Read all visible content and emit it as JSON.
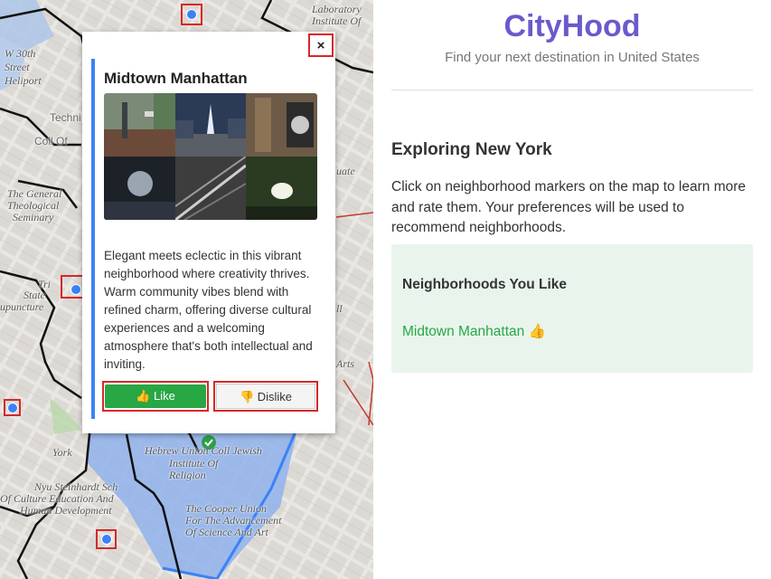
{
  "map": {
    "labels": [
      "Laboratory",
      "Institute Of",
      "W 30th",
      "Street",
      "Heliport",
      "Techni",
      "Coll Of",
      "The General",
      "Theological",
      "Seminary",
      "Tri",
      "State",
      "upuncture",
      "uate",
      "ll",
      "Arts",
      "York",
      "Hebrew Union Coll Jewish",
      "Institute Of",
      "Religion",
      "Nyu Steinhardt Sch",
      "Of Culture Education And",
      "Human Development",
      "The Cooper Union",
      "For The Advancement",
      "Of Science And Art"
    ]
  },
  "popup": {
    "close_label": "×",
    "title": "Midtown Manhattan",
    "description": "Elegant meets eclectic in this vibrant neighborhood where creativity thrives. Warm community vibes blend with refined charm, offering diverse cultural experiences and a welcoming atmosphere that's both intellectual and inviting.",
    "like_label": "👍 Like",
    "dislike_label": "👎 Dislike"
  },
  "panel": {
    "app_title": "CityHood",
    "subtitle": "Find your next destination in United States",
    "section_title": "Exploring New York",
    "description": "Click on neighborhood markers on the map to learn more and rate them. Your preferences will be used to recommend neighborhoods.",
    "liked_title": "Neighborhoods You Like",
    "liked_items": [
      "Midtown Manhattan 👍"
    ]
  },
  "colors": {
    "accent": "#6a5acd",
    "like": "#28a745",
    "marker": "#3b82f6",
    "highlight": "#d62828"
  }
}
